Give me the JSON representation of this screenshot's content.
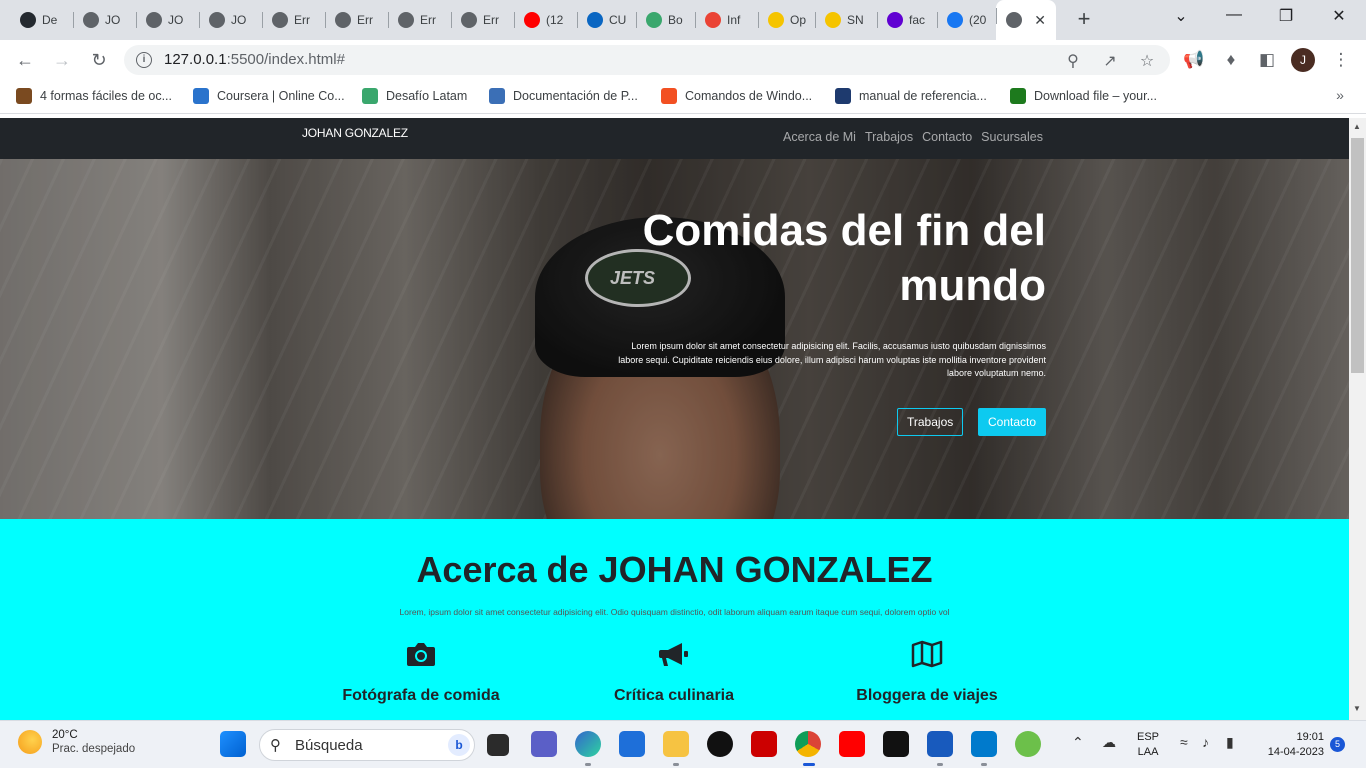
{
  "browser": {
    "tabs": [
      {
        "label": "De",
        "icon": "github-icon",
        "color": "#24292f"
      },
      {
        "label": "JO",
        "icon": "globe-icon",
        "color": "#5f6368"
      },
      {
        "label": "JO",
        "icon": "globe-icon",
        "color": "#5f6368"
      },
      {
        "label": "JO",
        "icon": "globe-icon",
        "color": "#5f6368"
      },
      {
        "label": "Err",
        "icon": "globe-icon",
        "color": "#5f6368"
      },
      {
        "label": "Err",
        "icon": "globe-icon",
        "color": "#5f6368"
      },
      {
        "label": "Err",
        "icon": "globe-icon",
        "color": "#5f6368"
      },
      {
        "label": "Err",
        "icon": "globe-icon",
        "color": "#5f6368"
      },
      {
        "label": "(12",
        "icon": "youtube-icon",
        "color": "#ff0000"
      },
      {
        "label": "CU",
        "icon": "linkedin-icon",
        "color": "#0a66c2"
      },
      {
        "label": "Bo",
        "icon": "desafio-icon",
        "color": "#3aa76d"
      },
      {
        "label": "Inf",
        "icon": "gmail-icon",
        "color": "#ea4335"
      },
      {
        "label": "Op",
        "icon": "sence-icon",
        "color": "#f5c400"
      },
      {
        "label": "SN",
        "icon": "sence-icon",
        "color": "#f5c400"
      },
      {
        "label": "fac",
        "icon": "yahoo-icon",
        "color": "#6001d2"
      },
      {
        "label": "(20",
        "icon": "facebook-icon",
        "color": "#1877f2"
      },
      {
        "label": "",
        "icon": "globe-icon",
        "color": "#5f6368",
        "active": true
      }
    ],
    "url_host": "127.0.0.1",
    "url_rest": ":5500/index.html#",
    "bookmarks": [
      {
        "label": "4 formas fáciles de oc...",
        "icon": "wikihow-icon",
        "color": "#7a4a20"
      },
      {
        "label": "Coursera | Online Co...",
        "icon": "coursera-icon",
        "color": "#2a73cc"
      },
      {
        "label": "Desafío Latam",
        "icon": "desafio-icon",
        "color": "#3aa76d"
      },
      {
        "label": "Documentación de P...",
        "icon": "docs-icon",
        "color": "#3b6fb6"
      },
      {
        "label": "Comandos de Windo...",
        "icon": "microsoft-icon",
        "color": "#f25022"
      },
      {
        "label": "manual de referencia...",
        "icon": "manual-icon",
        "color": "#1e3a6e"
      },
      {
        "label": "Download file – your...",
        "icon": "download-icon",
        "color": "#1d7a1d"
      }
    ],
    "avatar_letter": "J"
  },
  "site": {
    "brand": "JOHAN GONZALEZ",
    "nav": [
      "Acerca de Mi",
      "Trabajos",
      "Contacto",
      "Sucursales"
    ],
    "hero_title": "Comidas del fin del mundo",
    "hero_text": "Lorem ipsum dolor sit amet consectetur adipisicing elit. Facilis, accusamus iusto quibusdam dignissimos labore sequi. Cupiditate reiciendis eius dolore, illum adipisci harum voluptas iste mollitia inventore provident labore voluptatum nemo.",
    "btn_trabajos": "Trabajos",
    "btn_contacto": "Contacto",
    "about_title": "Acerca de JOHAN GONZALEZ",
    "about_sub": "Lorem, ipsum dolor sit amet consectetur adipisicing elit. Odio quisquam distinctio, odit laborum aliquam earum itaque cum sequi, dolorem optio vol",
    "features": [
      {
        "icon": "camera-icon",
        "label": "Fotógrafa de comida"
      },
      {
        "icon": "megaphone-icon",
        "label": "Crítica culinaria"
      },
      {
        "icon": "map-icon",
        "label": "Bloggera de viajes"
      }
    ],
    "accent_color": "#0dcaf0",
    "about_bg": "#00ffff"
  },
  "taskbar": {
    "temp": "20°C",
    "weather": "Prac. despejado",
    "search_placeholder": "Búsqueda",
    "lang1": "ESP",
    "lang2": "LAA",
    "time": "19:01",
    "date": "14-04-2023",
    "notifications": "5"
  }
}
